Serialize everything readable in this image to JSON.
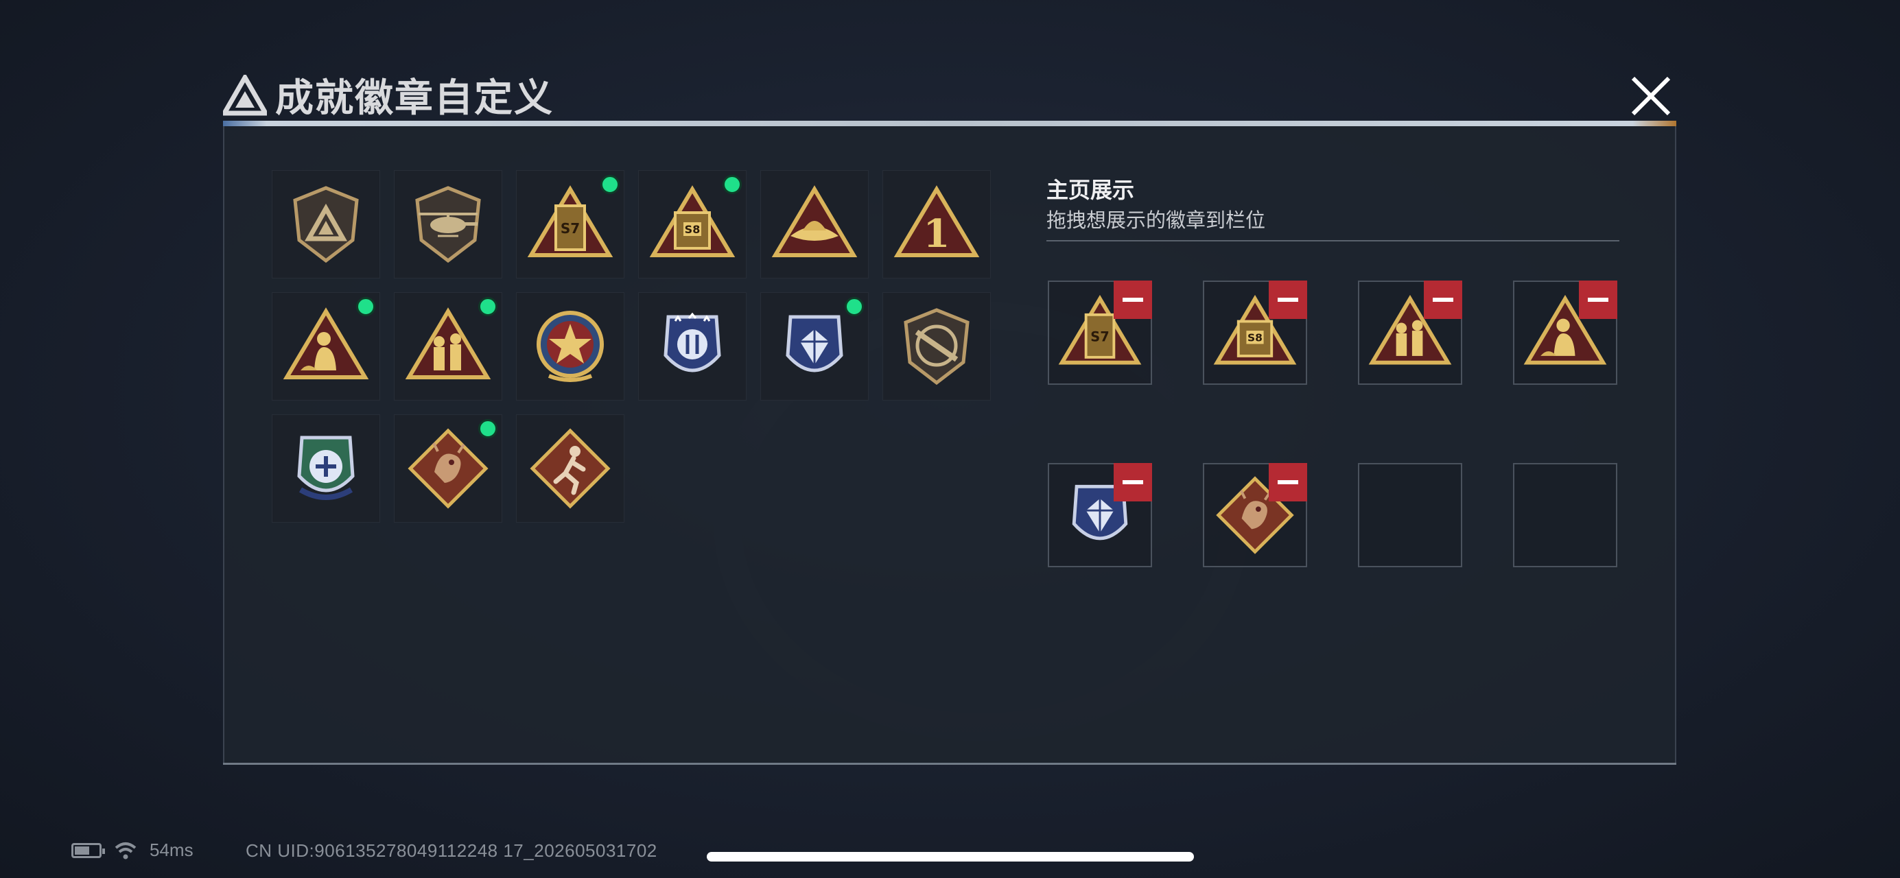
{
  "dialog": {
    "title": "成就徽章自定义"
  },
  "badges": [
    {
      "name": "tri-shield-plain",
      "new": false
    },
    {
      "name": "helicopter-shield",
      "new": false
    },
    {
      "name": "s7-pyramid",
      "new": true
    },
    {
      "name": "s8-pyramid",
      "new": true
    },
    {
      "name": "hat-pyramid",
      "new": false
    },
    {
      "name": "number-one-pyramid",
      "new": false
    },
    {
      "name": "soldier-pyramid",
      "new": true
    },
    {
      "name": "squad-pyramid",
      "new": true
    },
    {
      "name": "star-medal",
      "new": false
    },
    {
      "name": "blue-crest-badge",
      "new": false
    },
    {
      "name": "blue-diamond-crest-badge",
      "new": true
    },
    {
      "name": "rifle-shield",
      "new": false
    },
    {
      "name": "green-crest-badge",
      "new": false
    },
    {
      "name": "dragon-diamond",
      "new": true
    },
    {
      "name": "runner-diamond",
      "new": false
    }
  ],
  "showcase": {
    "title": "主页展示",
    "subtitle": "拖拽想展示的徽章到栏位",
    "slots": [
      {
        "badge": "s7-pyramid",
        "filled": true
      },
      {
        "badge": "s8-pyramid",
        "filled": true
      },
      {
        "badge": "squad-pyramid",
        "filled": true
      },
      {
        "badge": "soldier-pyramid",
        "filled": true
      },
      {
        "badge": "blue-diamond-crest-badge",
        "filled": true
      },
      {
        "badge": "dragon-diamond",
        "filled": true
      },
      {
        "badge": "",
        "filled": false
      },
      {
        "badge": "",
        "filled": false
      }
    ]
  },
  "status": {
    "ping": "54ms",
    "uid": "CN UID:906135278049112248 17_202605031702"
  },
  "colors": {
    "gold": "#d9b35a",
    "dark_red": "#5a1f1f",
    "remove_red": "#b52a33",
    "new_dot": "#1fe08a"
  }
}
